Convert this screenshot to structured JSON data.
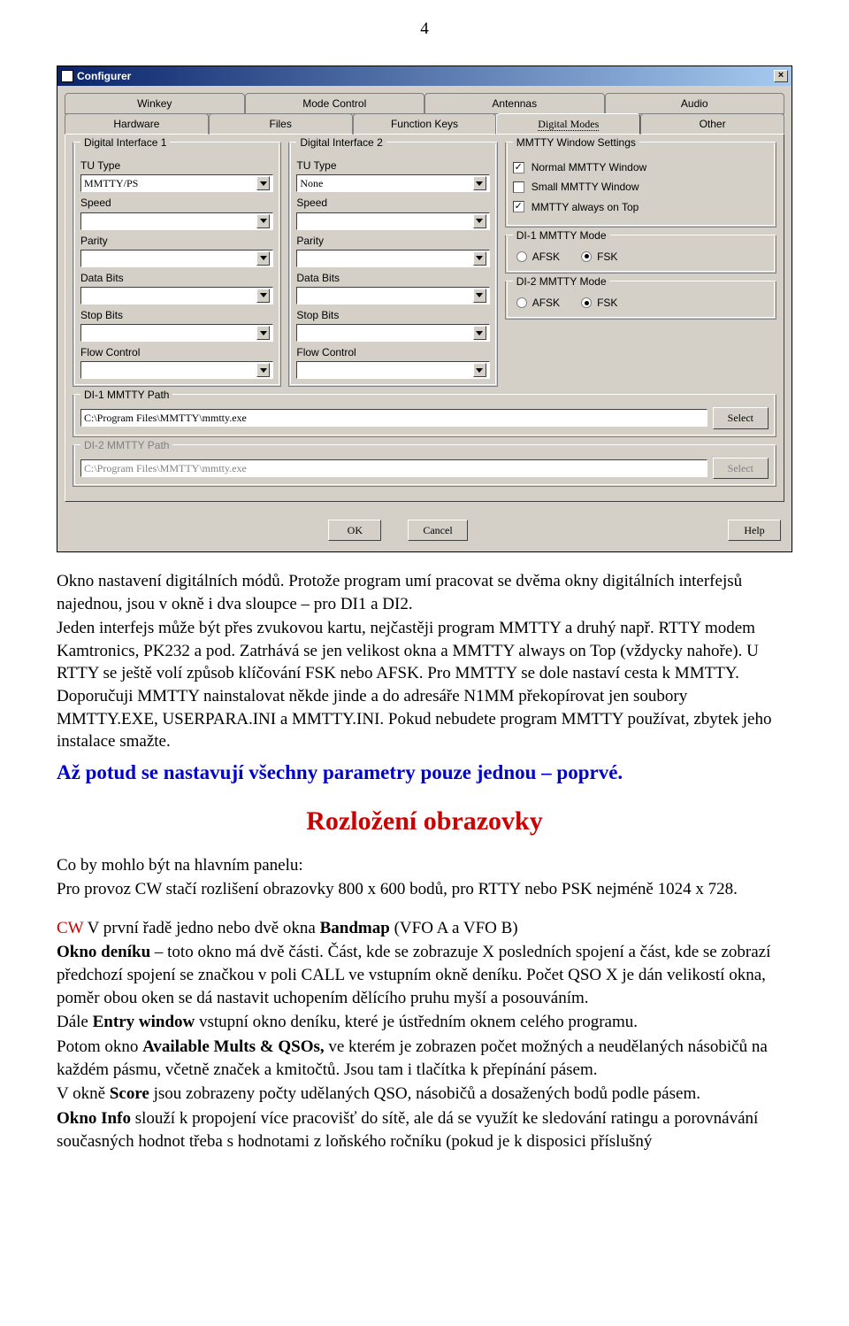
{
  "pageNumber": "4",
  "window": {
    "title": "Configurer",
    "close": "×",
    "tabsRow1": [
      "Winkey",
      "Mode Control",
      "Antennas",
      "Audio"
    ],
    "tabsRow2": [
      "Hardware",
      "Files",
      "Function Keys",
      "Digital Modes",
      "Other"
    ],
    "activeTab": "Digital Modes",
    "di1": {
      "groupTitle": "Digital Interface 1",
      "tuType": "TU Type",
      "tuTypeVal": "MMTTY/PS",
      "speed": "Speed",
      "parity": "Parity",
      "dataBits": "Data Bits",
      "stopBits": "Stop Bits",
      "flowControl": "Flow Control"
    },
    "di2": {
      "groupTitle": "Digital Interface 2",
      "tuType": "TU Type",
      "tuTypeVal": "None",
      "speed": "Speed",
      "parity": "Parity",
      "dataBits": "Data Bits",
      "stopBits": "Stop Bits",
      "flowControl": "Flow Control"
    },
    "mws": {
      "groupTitle": "MMTTY Window Settings",
      "opt1": "Normal MMTTY Window",
      "opt2": "Small MMTTY Window",
      "opt3": "MMTTY always on Top",
      "chk1": "✓",
      "chk2": "",
      "chk3": "✓"
    },
    "mode1": {
      "groupTitle": "DI-1 MMTTY Mode",
      "afsk": "AFSK",
      "fsk": "FSK"
    },
    "mode2": {
      "groupTitle": "DI-2 MMTTY Mode",
      "afsk": "AFSK",
      "fsk": "FSK"
    },
    "path1": {
      "groupTitle": "DI-1 MMTTY Path",
      "value": "C:\\Program Files\\MMTTY\\mmtty.exe",
      "select": "Select"
    },
    "path2": {
      "groupTitle": "DI-2 MMTTY Path",
      "value": "C:\\Program Files\\MMTTY\\mmtty.exe",
      "select": "Select"
    },
    "buttons": {
      "ok": "OK",
      "cancel": "Cancel",
      "help": "Help"
    }
  },
  "doc": {
    "p1": "Okno nastavení digitálních módů. Protože program umí pracovat se dvěma okny digitálních interfejsů najednou, jsou v okně i dva sloupce – pro  DI1 a DI2.",
    "p2": "Jeden interfejs může být přes zvukovou kartu, nejčastěji program MMTTY a druhý např. RTTY modem Kamtronics, PK232 a pod. Zatrhává  se jen velikost okna a MMTTY always on Top (vždycky nahoře). U RTTY se ještě volí způsob klíčování FSK nebo AFSK. Pro MMTTY se dole nastaví cesta k MMTTY. Doporučuji MMTTY nainstalovat někde jinde a do adresáře N1MM překopírovat jen soubory MMTTY.EXE, USERPARA.INI a MMTTY.INI. Pokud nebudete program MMTTY používat, zbytek jeho instalace smažte.",
    "blue": "Až potud se nastavují všechny parametry pouze jednou – poprvé.",
    "redHeading": "Rozložení obrazovky",
    "p3a": "Co by mohlo být na hlavním panelu:",
    "p3b": "Pro provoz CW stačí rozlišení obrazovky 800 x 600 bodů, pro RTTY nebo PSK nejméně 1024 x 728.",
    "cwLabel": "CW",
    "p4": "        V první řadě jedno nebo dvě okna ",
    "p4b": "Bandmap",
    "p4c": "  (VFO A  a  VFO B)",
    "p5a": "Okno deníku",
    "p5b": " – toto okno má dvě části. Část, kde se zobrazuje X posledních spojení a část, kde se zobrazí předchozí spojení se značkou v poli CALL ve vstupním okně deníku. Počet QSO X je dán velikostí okna, poměr obou oken se dá nastavit uchopením dělícího pruhu myší a posouváním.",
    "p6a": "Dále ",
    "p6b": "Entry window",
    "p6c": " vstupní okno deníku, které je ústředním oknem celého programu.",
    "p7a": "Potom okno ",
    "p7b": "Available Mults & QSOs,",
    "p7c": " ve kterém je zobrazen počet možných a neudělaných násobičů na každém pásmu, včetně značek a kmitočtů.  Jsou tam i tlačítka k přepínání pásem.",
    "p8a": "V okně ",
    "p8b": "Score",
    "p8c": " jsou zobrazeny počty udělaných QSO, násobičů a dosažených bodů podle pásem.",
    "p9a": "Okno Info",
    "p9b": " slouží k propojení více pracovišť do sítě, ale dá se využít ke sledování ratingu a porovnávání současných hodnot třeba s hodnotami z loňského ročníku (pokud je k disposici příslušný"
  }
}
